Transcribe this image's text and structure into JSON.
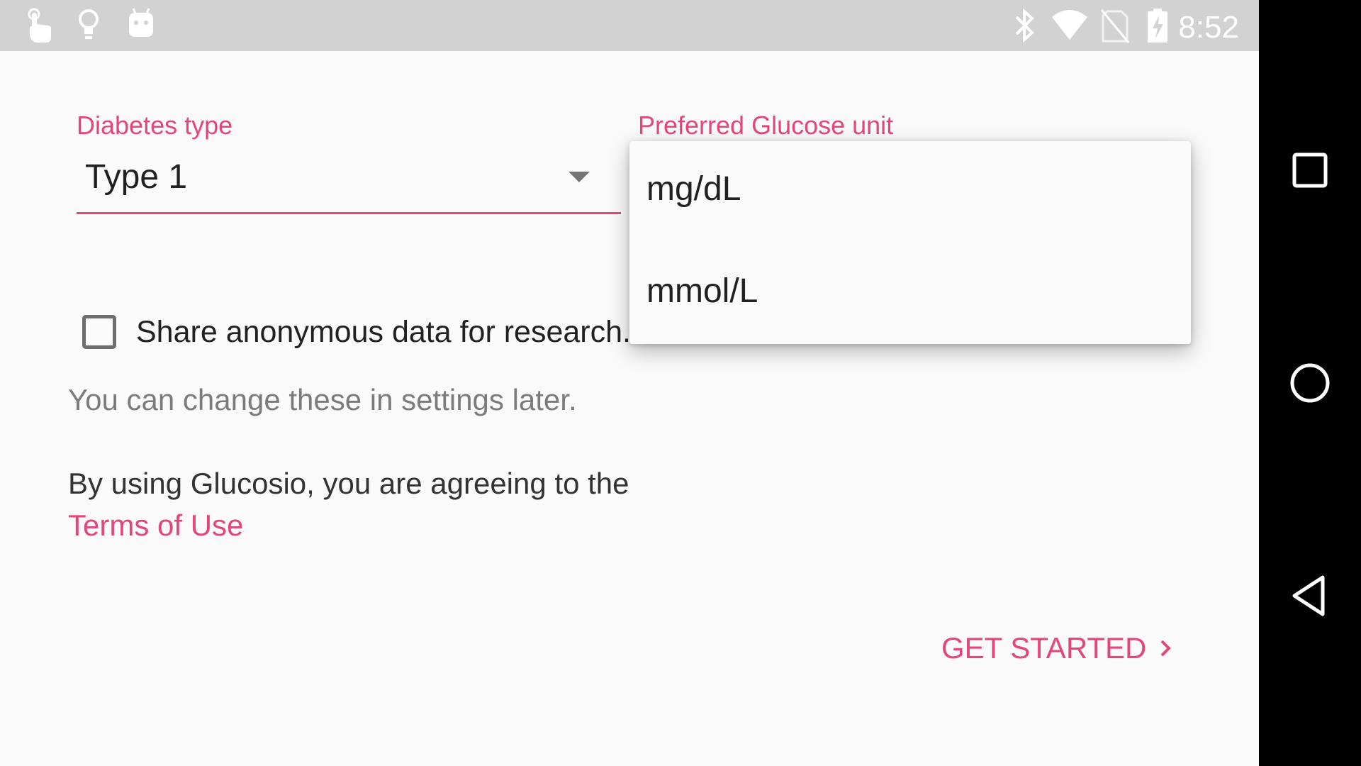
{
  "status_bar": {
    "time": "8:52",
    "left_icons": [
      "touch-icon",
      "lightbulb-icon",
      "android-icon"
    ],
    "right_icons": [
      "bluetooth-icon",
      "wifi-icon",
      "no-sim-icon",
      "battery-charging-icon"
    ]
  },
  "form": {
    "diabetes_type": {
      "label": "Diabetes type",
      "value": "Type 1"
    },
    "glucose_unit": {
      "label": "Preferred Glucose unit",
      "options": [
        "mg/dL",
        "mmol/L"
      ]
    },
    "share_data": {
      "label": "Share anonymous data for research.",
      "checked": false
    },
    "hint": "You can change these in settings later.",
    "terms": {
      "text": "By using Glucosio, you are agreeing to the",
      "link": "Terms of Use"
    },
    "get_started": "GET STARTED"
  },
  "colors": {
    "accent": "#e2467c",
    "status_bar": "#d2d2d2",
    "background": "#fafafa"
  }
}
